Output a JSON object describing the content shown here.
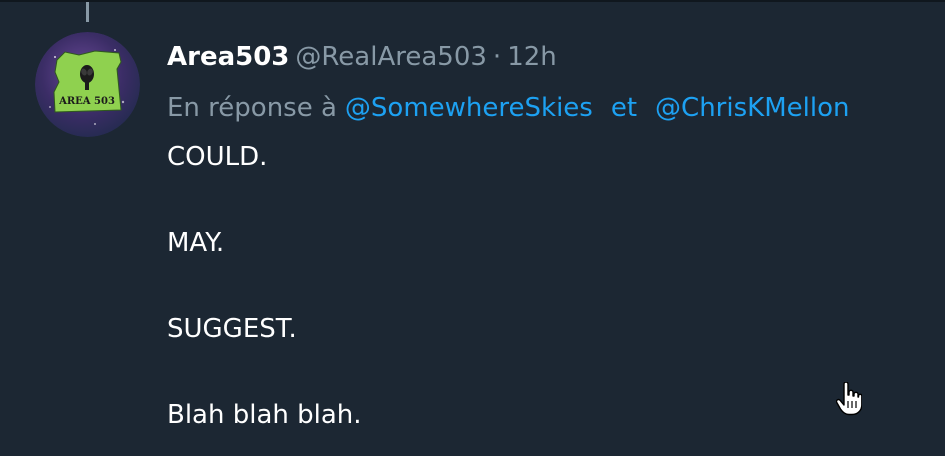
{
  "tweet": {
    "display_name": "Area503",
    "handle": "@RealArea503",
    "separator": "·",
    "time": "12h",
    "reply_prefix": "En réponse à",
    "reply_mentions": [
      "@SomewhereSkies",
      "@ChrisKMellon"
    ],
    "reply_conjunction": "et",
    "text_paragraphs": [
      "COULD.",
      "MAY.",
      "SUGGEST.",
      "Blah blah blah."
    ],
    "avatar_text": "AREA 503"
  },
  "colors": {
    "background": "#1c2733",
    "mention": "#1da1f2",
    "secondary_text": "#8899a6",
    "primary_text": "#ffffff",
    "avatar_green": "#8fd14f"
  },
  "icons": {
    "avatar": "alien-oregon-logo",
    "cursor": "hand-pointer-icon"
  }
}
